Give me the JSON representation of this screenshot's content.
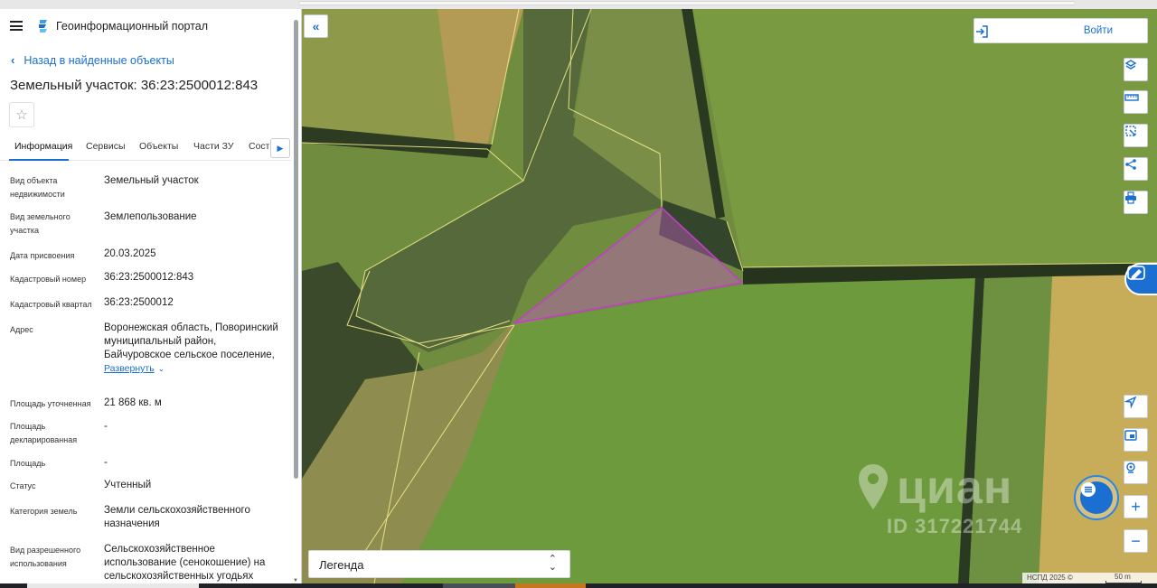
{
  "app": {
    "portal_title": "Геоинформационный портал"
  },
  "nav": {
    "back_label": "Назад в найденные объекты"
  },
  "object": {
    "title": "Земельный участок: 36:23:2500012:843"
  },
  "tabs": [
    {
      "label": "Информация",
      "active": true
    },
    {
      "label": "Сервисы"
    },
    {
      "label": "Объекты"
    },
    {
      "label": "Части ЗУ"
    },
    {
      "label": "Соста"
    }
  ],
  "properties": [
    {
      "label": "Вид объекта недвижимости",
      "value": "Земельный участок"
    },
    {
      "label": "Вид земельного участка",
      "value": "Землепользование"
    },
    {
      "label": "Дата присвоения",
      "value": "20.03.2025"
    },
    {
      "label": "Кадастровый номер",
      "value": "36:23:2500012:843"
    },
    {
      "label": "Кадастровый квартал",
      "value": "36:23:2500012"
    },
    {
      "label": "Адрес",
      "value": "Воронежская область, Поворинский муниципальный район, Байчуровское сельское поселение,",
      "expand_label": "Развернуть"
    },
    {
      "label": "Площадь уточненная",
      "value": "21 868 кв. м"
    },
    {
      "label": "Площадь декларированная",
      "value": "-"
    },
    {
      "label": "Площадь",
      "value": "-"
    },
    {
      "label": "Статус",
      "value": "Учтенный"
    },
    {
      "label": "Категория земель",
      "value": "Земли сельскохозяйственного назначения"
    },
    {
      "label": "Вид разрешенного использования",
      "value": "Сельскохозяйственное использование (сенокошение) на сельскохозяйственных угодьях"
    }
  ],
  "map": {
    "login_label": "Войти",
    "legend_label": "Легенда",
    "attribution": "НСПД 2025 ©",
    "scale_label": "50 m",
    "watermark_brand": "циан",
    "watermark_id": "ID 317221744",
    "parcel_color": "#c23ec9",
    "boundary_color": "#f3ec8a",
    "accent_color": "#1a6fd0",
    "tools": [
      "layers-icon",
      "ruler-icon",
      "select-area-icon",
      "share-icon",
      "print-icon"
    ],
    "bottom_tools": [
      "locate-icon",
      "minimap-icon",
      "geo-search-icon",
      "zoom-in-icon",
      "zoom-out-icon"
    ]
  }
}
